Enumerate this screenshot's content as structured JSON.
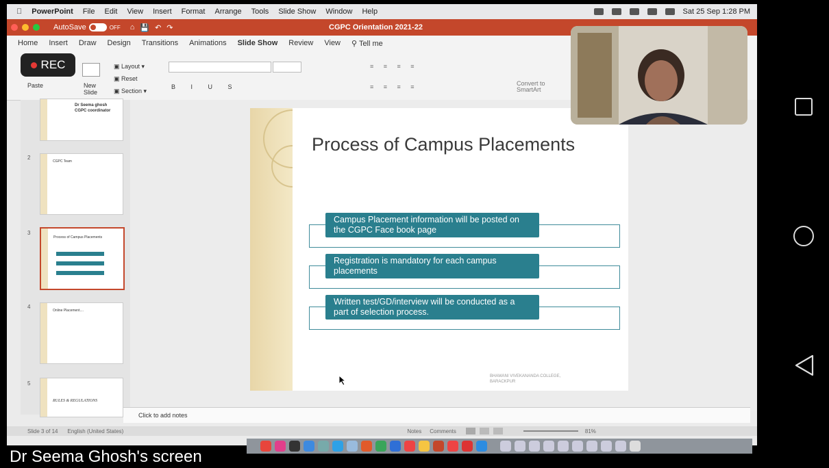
{
  "menubar": {
    "app": "PowerPoint",
    "items": [
      "File",
      "Edit",
      "View",
      "Insert",
      "Format",
      "Arrange",
      "Tools",
      "Slide Show",
      "Window",
      "Help"
    ],
    "clock": "Sat 25 Sep 1:28 PM"
  },
  "titlebar": {
    "autosave": "AutoSave",
    "autosave_state": "OFF",
    "doc_title": "CGPC Orientation 2021-22"
  },
  "ribbon": {
    "tabs": [
      "Home",
      "Insert",
      "Draw",
      "Design",
      "Transitions",
      "Animations",
      "Slide Show",
      "Review",
      "View",
      "Tell me"
    ],
    "active_tab": "Slide Show",
    "paste": "Paste",
    "new_slide": "New Slide",
    "layout": "Layout",
    "reset": "Reset",
    "section": "Section",
    "convert": "Convert to SmartArt"
  },
  "rec": {
    "label": "REC",
    "color": "#e53935"
  },
  "thumbnails": [
    {
      "num": "",
      "title": "",
      "lines": [
        "Dr Seema ghosh",
        "CGPC coordinator"
      ]
    },
    {
      "num": "2",
      "title": "CGPC Team",
      "lines": []
    },
    {
      "num": "3",
      "title": "Process of Campus Placements",
      "lines": []
    },
    {
      "num": "4",
      "title": "Online Placement....",
      "lines": []
    },
    {
      "num": "5",
      "title": "RULES & REGULATIONS",
      "lines": []
    }
  ],
  "slide": {
    "title": "Process of Campus Placements",
    "steps": [
      "Campus Placement information will be posted on the CGPC Face book page",
      "Registration is mandatory for each campus placements",
      "Written test/GD/interview will be conducted as a part of selection process."
    ],
    "footer": [
      "BHAWANI VIVEKANANDA COLLEGE,",
      "BARACKPUR"
    ],
    "accent": "#2a7f8e"
  },
  "notes": {
    "placeholder": "Click to add notes"
  },
  "status": {
    "slide_count": "Slide 3 of 14",
    "language": "English (United States)",
    "notes": "Notes",
    "comments": "Comments",
    "zoom": "81%"
  },
  "caption": "Dr Seema Ghosh's screen"
}
